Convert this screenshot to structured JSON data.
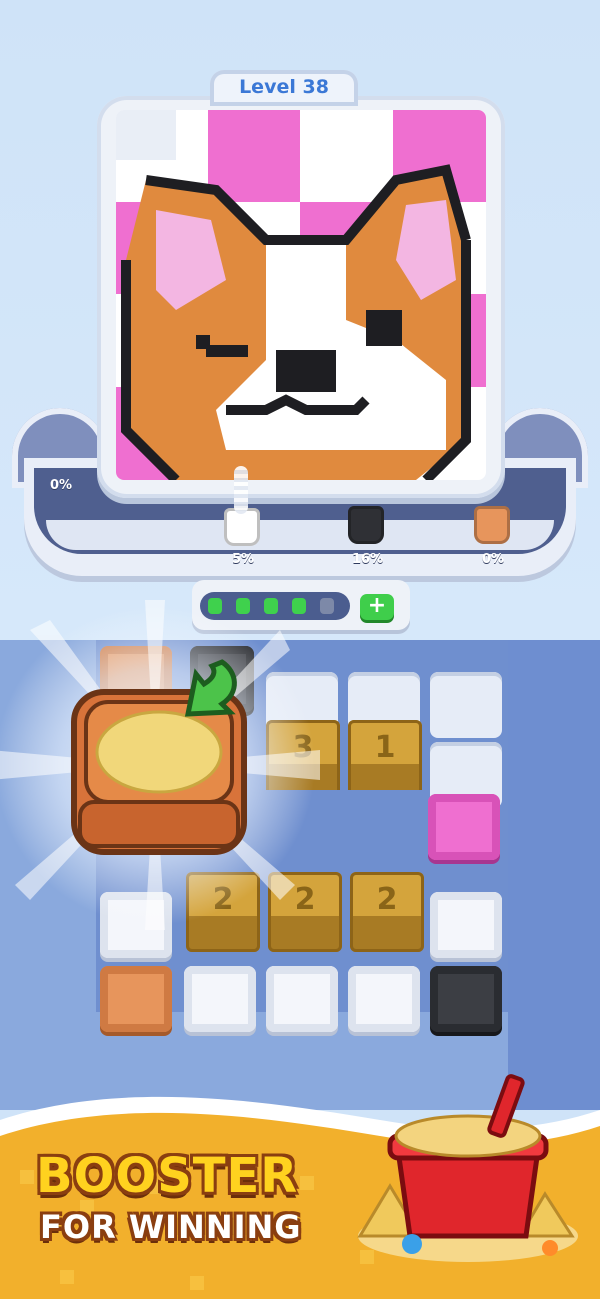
{
  "game": {
    "level_label": "Level 38",
    "picture_subject": "corgi-dog-pixel-art"
  },
  "colors": {
    "pink": "#ef6fd0",
    "orange": "#e7955c",
    "black": "#2b2b2e",
    "white": "#ffffff",
    "crate": "#d4a43c",
    "progress_green": "#3fd14d"
  },
  "conveyor": {
    "left_percent": "0%",
    "cups": [
      {
        "color": "white",
        "percent": "5%"
      },
      {
        "color": "black",
        "percent": "16%"
      },
      {
        "color": "orange",
        "percent": "0%"
      }
    ]
  },
  "progress": {
    "segments_filled": 4,
    "segments_total": 5,
    "add_button_label": "+"
  },
  "board": {
    "crates_row1": [
      "3",
      "1"
    ],
    "crates_row2": [
      "2",
      "2",
      "2"
    ]
  },
  "booster": {
    "icon": "sand-cup-with-arrow-icon"
  },
  "promo": {
    "line1": "BOOSTER",
    "line2": "FOR WINNING"
  }
}
